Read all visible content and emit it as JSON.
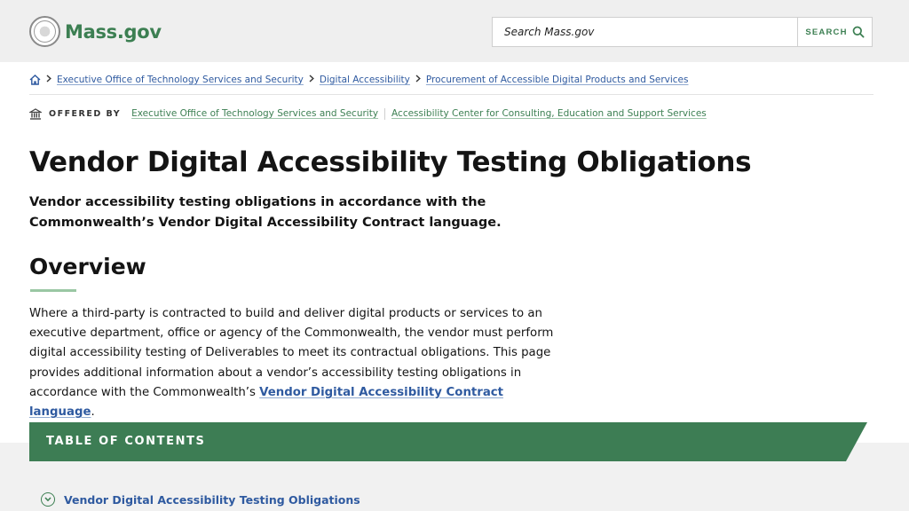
{
  "header": {
    "logo_text": "Mass.gov",
    "search_placeholder": "Search Mass.gov",
    "search_button_label": "SEARCH"
  },
  "breadcrumb": {
    "items": [
      "Executive Office of Technology Services and Security",
      "Digital Accessibility",
      "Procurement of Accessible Digital Products and Services"
    ]
  },
  "offered_by": {
    "label": "OFFERED BY",
    "organizations": [
      "Executive Office of Technology Services and Security",
      "Accessibility Center for Consulting, Education and Support Services"
    ]
  },
  "page": {
    "title": "Vendor Digital Accessibility Testing Obligations",
    "subtitle": "Vendor accessibility testing obligations in accordance with the Commonwealth’s Vendor Digital Accessibility Contract language."
  },
  "overview": {
    "heading": "Overview",
    "body_text": "Where a third-party is contracted to build and deliver digital products or services to an executive department, office or agency of the Commonwealth, the vendor must perform digital accessibility testing of Deliverables to meet its contractual obligations. This page provides additional information about a vendor’s accessibility testing obligations in accordance with the Commonwealth’s ",
    "link_text": "Vendor Digital Accessibility Contract language",
    "body_end": "."
  },
  "toc": {
    "title": "TABLE OF CONTENTS",
    "items": [
      "Vendor Digital Accessibility Testing Obligations"
    ]
  },
  "colors": {
    "brand_green": "#3c7f52",
    "link_blue": "#2f5aa0",
    "toc_banner": "#3d7d54",
    "header_bg": "#efefef"
  },
  "icons": [
    "mass-seal-icon",
    "search-icon",
    "home-icon",
    "chevron-right-icon",
    "building-icon",
    "chevron-down-circle-icon"
  ]
}
